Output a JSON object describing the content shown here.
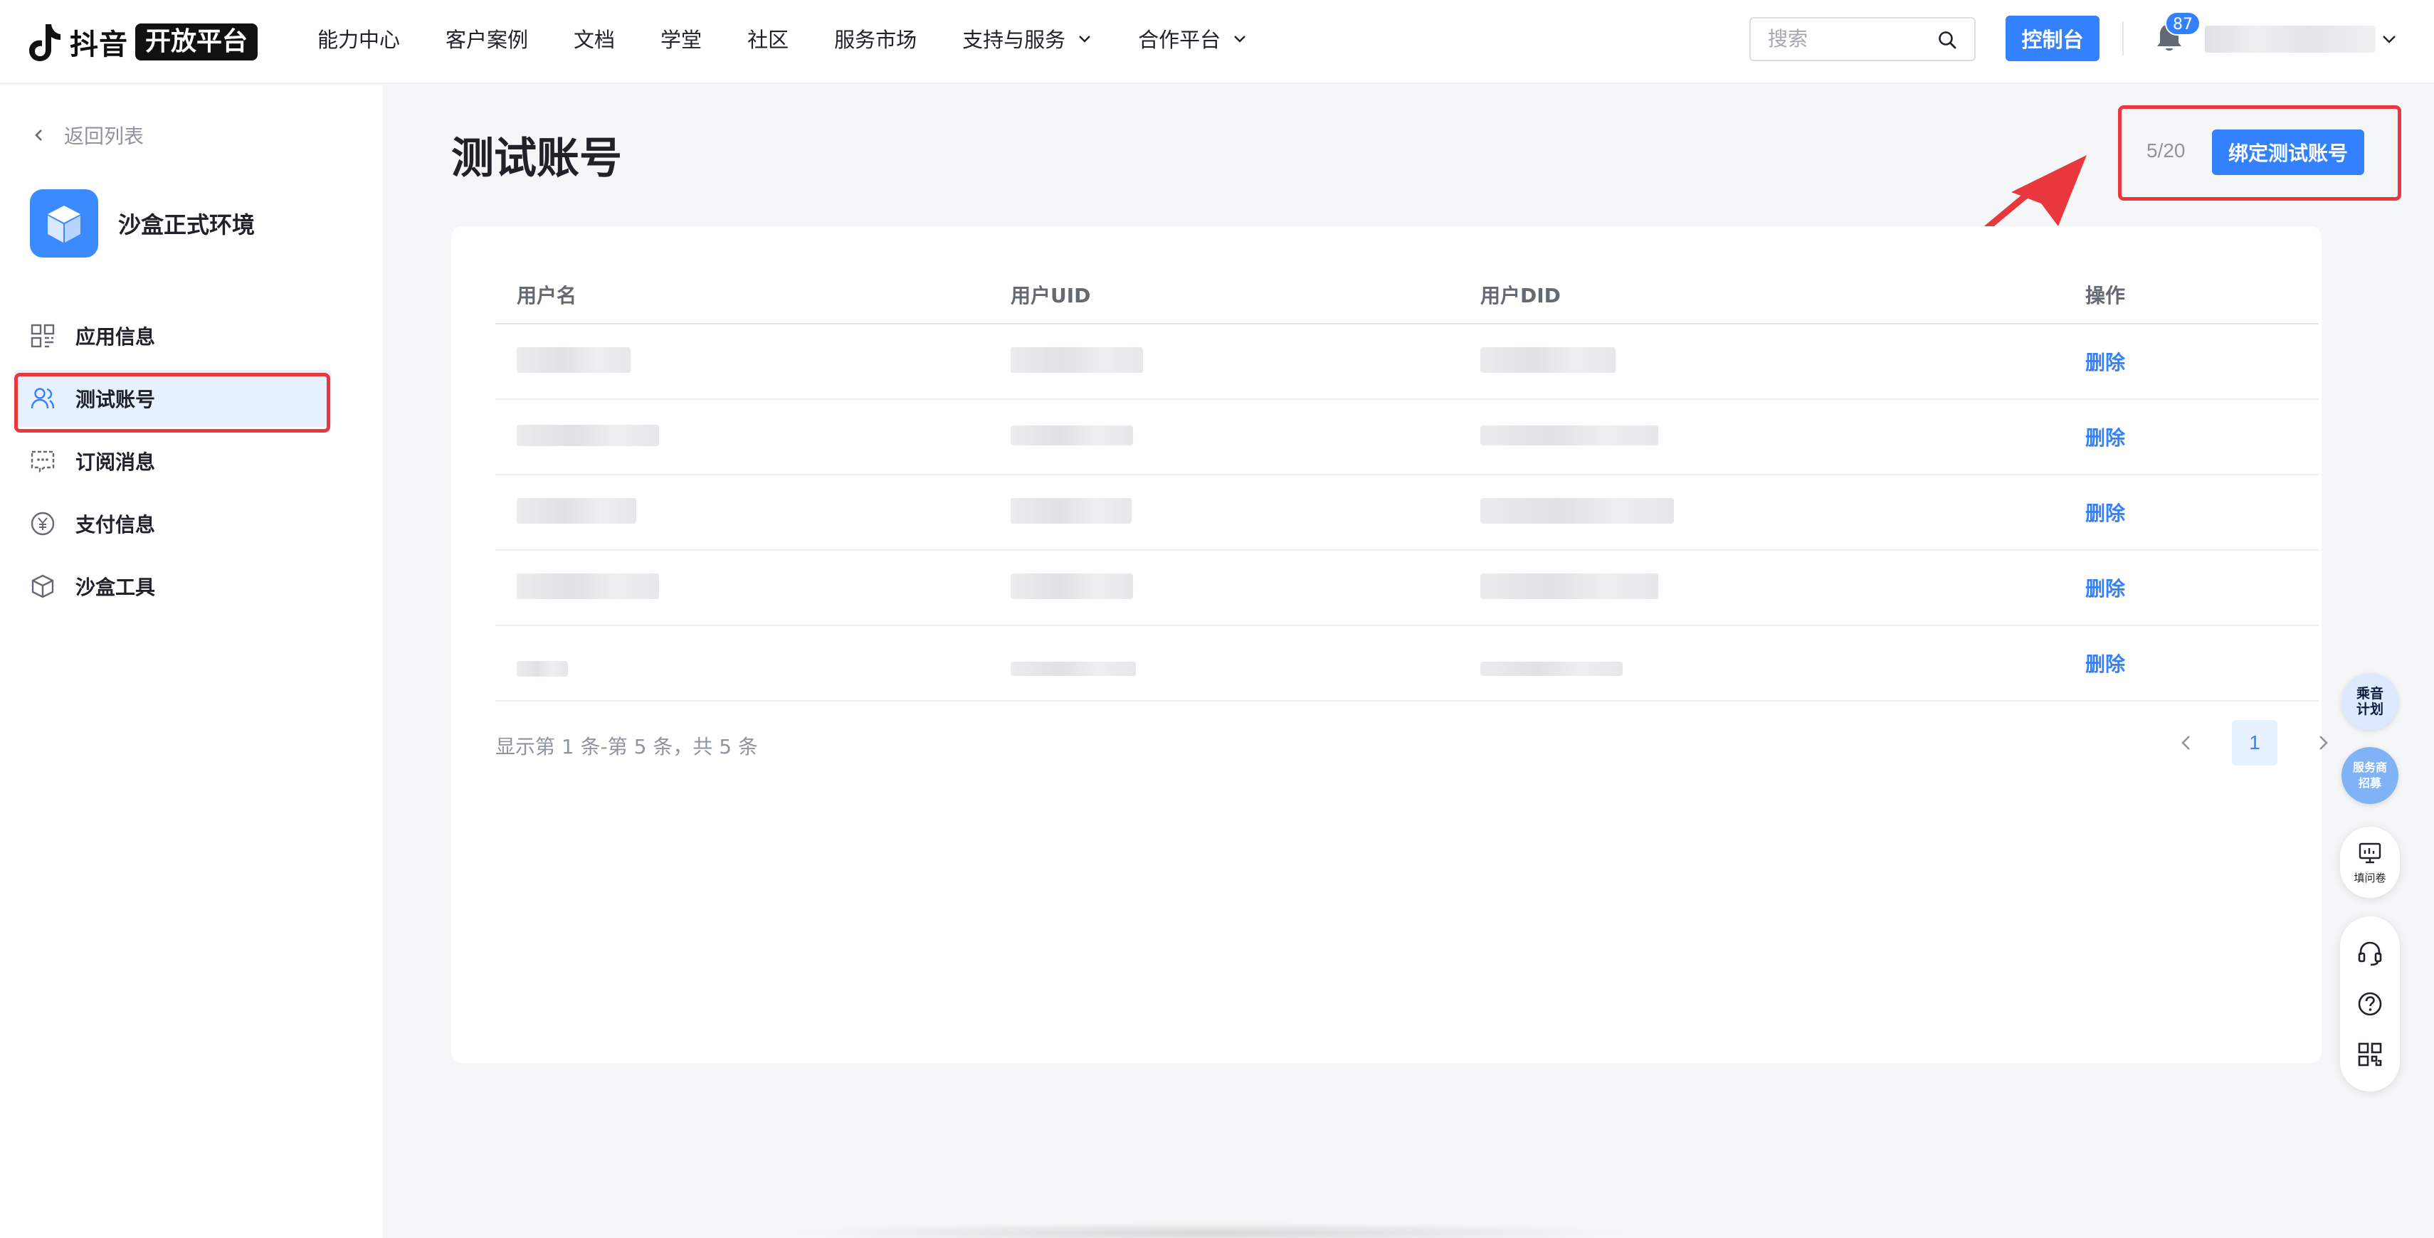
{
  "brand": {
    "name": "抖音",
    "badge": "开放平台"
  },
  "nav": {
    "items": [
      {
        "label": "能力中心",
        "has_dropdown": false
      },
      {
        "label": "客户案例",
        "has_dropdown": false
      },
      {
        "label": "文档",
        "has_dropdown": false
      },
      {
        "label": "学堂",
        "has_dropdown": false
      },
      {
        "label": "社区",
        "has_dropdown": false
      },
      {
        "label": "服务市场",
        "has_dropdown": false
      },
      {
        "label": "支持与服务",
        "has_dropdown": true
      },
      {
        "label": "合作平台",
        "has_dropdown": true
      }
    ],
    "search_placeholder": "搜索",
    "console_label": "控制台",
    "notification_count": "87"
  },
  "sidebar": {
    "back_label": "返回列表",
    "app_name": "沙盒正式环境",
    "items": [
      {
        "label": "应用信息",
        "icon": "grid-icon",
        "active": false
      },
      {
        "label": "测试账号",
        "icon": "users-icon",
        "active": true
      },
      {
        "label": "订阅消息",
        "icon": "message-icon",
        "active": false
      },
      {
        "label": "支付信息",
        "icon": "yen-icon",
        "active": false
      },
      {
        "label": "沙盒工具",
        "icon": "box-icon",
        "active": false
      }
    ]
  },
  "main": {
    "title": "测试账号",
    "quota": "5/20",
    "bind_button": "绑定测试账号",
    "table": {
      "columns": [
        "用户名",
        "用户UID",
        "用户DID",
        "操作"
      ],
      "rows": [
        {
          "action": "删除"
        },
        {
          "action": "删除"
        },
        {
          "action": "删除"
        },
        {
          "action": "删除"
        },
        {
          "action": "删除"
        }
      ]
    },
    "summary": "显示第 1 条-第 5 条，共 5 条",
    "pagination": {
      "current": "1"
    }
  },
  "floating": {
    "plan_badge": "乘音计划",
    "recruit_badge": "服务商招募",
    "survey_label": "填问卷"
  },
  "colors": {
    "accent": "#3381ff",
    "highlight": "#e8383d",
    "active_bg": "#e8f1ff"
  }
}
